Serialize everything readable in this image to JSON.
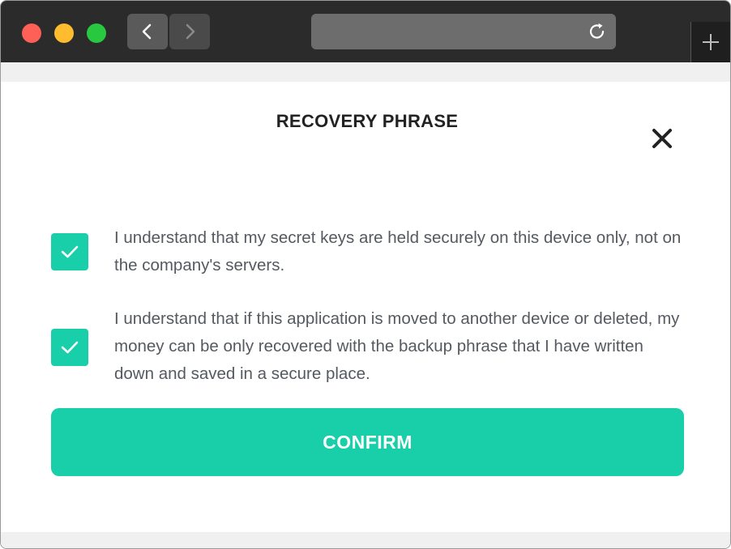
{
  "browser": {
    "window_controls": [
      "close-light",
      "minimize-light",
      "zoom-light"
    ],
    "icons": {
      "back": "chevron-left-icon",
      "forward": "chevron-right-icon",
      "reload": "reload-icon",
      "new_tab": "plus-icon"
    },
    "url": ""
  },
  "dialog": {
    "title": "RECOVERY PHRASE",
    "close_icon": "close-icon",
    "statements": [
      {
        "checked": true,
        "text": "I understand that my secret keys are held securely on this device only, not on the company's servers."
      },
      {
        "checked": true,
        "text": "I understand that if this application is moved to another device or deleted, my money can be only recovered with the backup phrase that I have written down and saved in a secure place."
      }
    ],
    "confirm_label": "CONFIRM"
  },
  "colors": {
    "accent": "#19cfa9",
    "titlebar": "#2b2b2b",
    "text": "#555a60",
    "title": "#222222"
  }
}
